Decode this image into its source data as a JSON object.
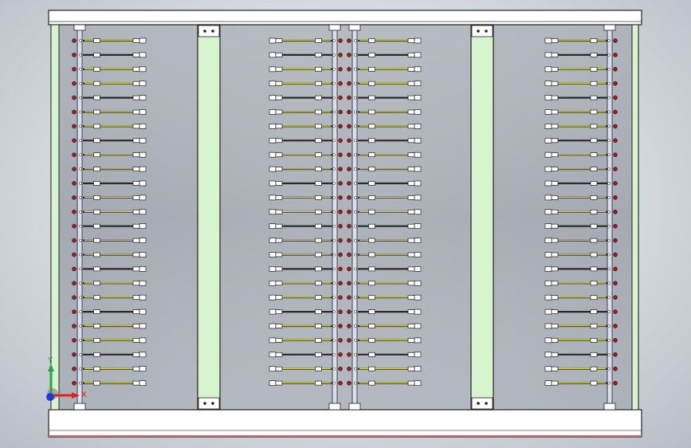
{
  "view": {
    "background_top": "#eceff3",
    "background_bottom": "#b9bec6"
  },
  "model": {
    "frame_color": "#ffffff",
    "frame_edge": "#222222",
    "post_fill": "#d6f5cf",
    "bracket_fill": "#ffffff",
    "rod_yellow": "#d8d23a",
    "rod_dark": "#2b2b2b",
    "bolt_red": "#9b1c1c",
    "bolt_white": "#ffffff",
    "bottom_edge_red": "#c86b6b",
    "rows_per_bank": 25
  },
  "triad": {
    "x_label": "X",
    "y_label": "Y",
    "x_color": "#e0221b",
    "y_color": "#2aa64a",
    "z_color": "#1d37d8"
  }
}
